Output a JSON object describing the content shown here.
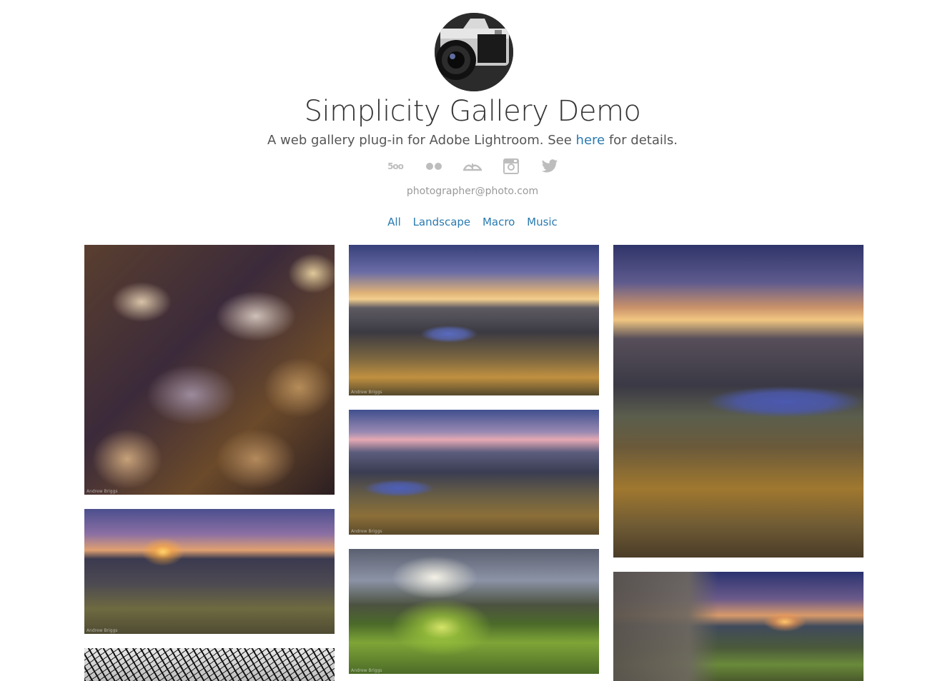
{
  "header": {
    "title": "Simplicity Gallery Demo",
    "subtitle_before": "A web gallery plug-in for Adobe Lightroom. See ",
    "subtitle_link": "here",
    "subtitle_after": " for details.",
    "email": "photographer@photo.com"
  },
  "social": [
    {
      "icon": "500px-icon",
      "glyph": "5oo"
    },
    {
      "icon": "flickr-icon",
      "glyph": "●●"
    },
    {
      "icon": "deviantart-icon",
      "glyph": "dA"
    },
    {
      "icon": "instagram-icon",
      "glyph": ""
    },
    {
      "icon": "twitter-icon",
      "glyph": ""
    }
  ],
  "categories": [
    "All",
    "Landscape",
    "Macro",
    "Music"
  ],
  "photo_credit": "Andrew Briggs",
  "colors": {
    "link": "#2a7ab0",
    "icon_gray": "#bdbdbd",
    "text": "#333333",
    "muted": "#999999"
  }
}
